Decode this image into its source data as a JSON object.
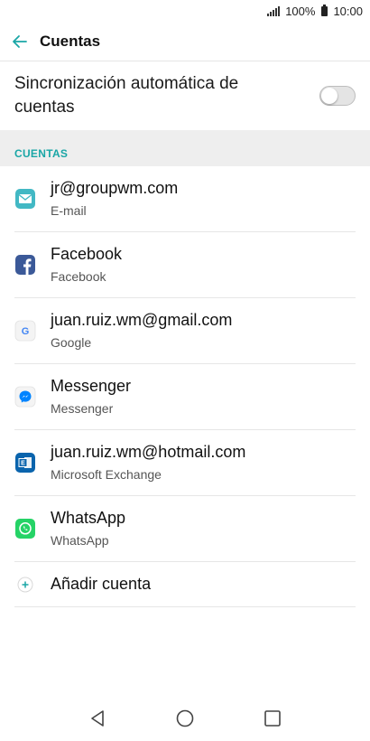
{
  "status_bar": {
    "battery": "100%",
    "time": "10:00"
  },
  "app_bar": {
    "title": "Cuentas"
  },
  "sync": {
    "label": "Sincronización automática de cuentas",
    "enabled": false
  },
  "section": {
    "header": "CUENTAS"
  },
  "accounts": [
    {
      "title": "jr@groupwm.com",
      "subtitle": "E-mail",
      "icon": "email-icon"
    },
    {
      "title": "Facebook",
      "subtitle": "Facebook",
      "icon": "facebook-icon"
    },
    {
      "title": "juan.ruiz.wm@gmail.com",
      "subtitle": "Google",
      "icon": "google-icon"
    },
    {
      "title": "Messenger",
      "subtitle": "Messenger",
      "icon": "messenger-icon"
    },
    {
      "title": "juan.ruiz.wm@hotmail.com",
      "subtitle": "Microsoft Exchange",
      "icon": "exchange-icon"
    },
    {
      "title": "WhatsApp",
      "subtitle": "WhatsApp",
      "icon": "whatsapp-icon"
    }
  ],
  "add_account": {
    "label": "Añadir cuenta"
  },
  "colors": {
    "accent": "#1aa6a6",
    "toggle_off": "#e4e4e4"
  }
}
